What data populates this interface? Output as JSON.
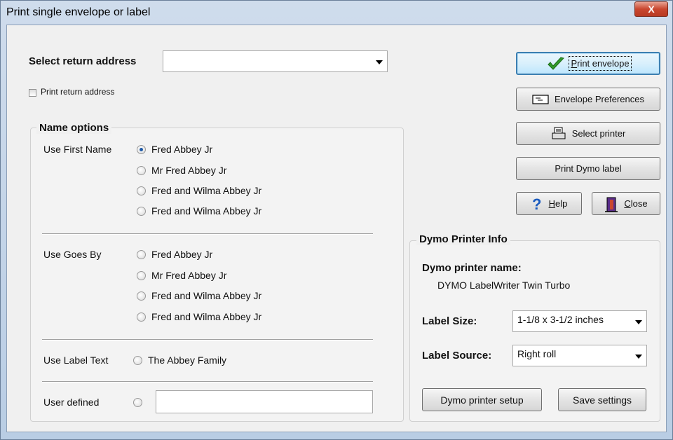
{
  "window": {
    "title": "Print single envelope or label",
    "close_glyph": "X"
  },
  "return_address": {
    "label": "Select return address",
    "value": "",
    "print_return_address_label": "Print return address",
    "print_return_address_checked": false
  },
  "name_options": {
    "title": "Name options",
    "first_name": {
      "label": "Use First Name",
      "options": [
        "Fred Abbey Jr",
        "Mr Fred Abbey Jr",
        "Fred and Wilma Abbey Jr",
        "Fred and Wilma Abbey Jr"
      ],
      "selected_index": 0
    },
    "goes_by": {
      "label": "Use Goes By",
      "options": [
        "Fred Abbey Jr",
        "Mr Fred Abbey Jr",
        "Fred and Wilma Abbey Jr",
        "Fred and Wilma Abbey Jr"
      ]
    },
    "label_text": {
      "label": "Use Label Text",
      "option": "The Abbey Family"
    },
    "user_defined": {
      "label": "User defined",
      "value": ""
    }
  },
  "buttons": {
    "print_envelope": {
      "prefix": "",
      "hotkey": "P",
      "rest": "rint envelope",
      "icon": "check-icon"
    },
    "envelope_preferences": {
      "label": "Envelope Preferences",
      "icon": "envelope-icon"
    },
    "select_printer": {
      "label": "Select printer",
      "icon": "printer-icon"
    },
    "print_dymo_label": {
      "label": "Print Dymo label"
    },
    "help": {
      "hotkey": "H",
      "rest": "elp",
      "icon": "question-icon"
    },
    "close": {
      "hotkey": "C",
      "rest": "lose",
      "icon": "door-icon"
    }
  },
  "dymo": {
    "title": "Dymo Printer Info",
    "printer_name_label": "Dymo printer name:",
    "printer_name_value": "DYMO LabelWriter Twin Turbo",
    "label_size_label": "Label Size:",
    "label_size_value": "1-1/8  x  3-1/2 inches",
    "label_source_label": "Label Source:",
    "label_source_value": "Right roll",
    "setup_button": "Dymo printer setup",
    "save_button": "Save settings"
  },
  "colors": {
    "check_green": "#2f9a2a",
    "help_blue": "#1a5bbf",
    "close_red": "#c9472f",
    "accent_blue": "#3c7fb1"
  }
}
